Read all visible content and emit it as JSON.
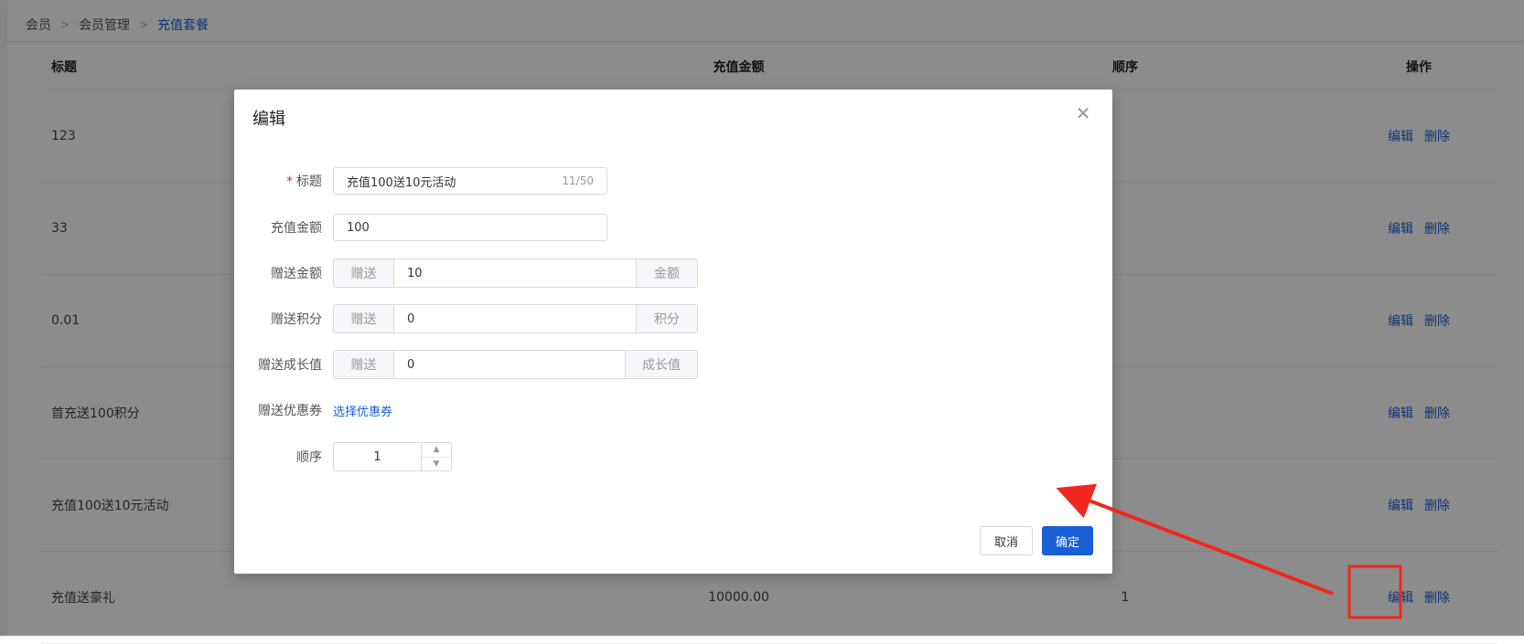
{
  "breadcrumb": [
    "会员",
    "会员管理",
    "充值套餐"
  ],
  "table": {
    "columns": [
      "标题",
      "充值金额",
      "顺序",
      "操作"
    ],
    "rows": [
      {
        "title": "123",
        "amount": "",
        "order": ""
      },
      {
        "title": "33",
        "amount": "",
        "order": ""
      },
      {
        "title": "0.01",
        "amount": "",
        "order": ""
      },
      {
        "title": "首充送100积分",
        "amount": "",
        "order": ""
      },
      {
        "title": "充值100送10元活动",
        "amount": "",
        "order": ""
      },
      {
        "title": "充值送豪礼",
        "amount": "10000.00",
        "order": "1"
      }
    ],
    "edit_label": "编辑",
    "delete_label": "删除"
  },
  "dialog": {
    "title": "编辑",
    "fields": {
      "title_label": "标题",
      "title_value": "充值100送10元活动",
      "title_count": "11/50",
      "amount_label": "充值金额",
      "amount_value": "100",
      "gift_amount_label": "赠送金额",
      "gift_amount_prefix": "赠送",
      "gift_amount_value": "10",
      "gift_amount_suffix": "金额",
      "gift_points_label": "赠送积分",
      "gift_points_prefix": "赠送",
      "gift_points_value": "0",
      "gift_points_suffix": "积分",
      "gift_growth_label": "赠送成长值",
      "gift_growth_prefix": "赠送",
      "gift_growth_value": "0",
      "gift_growth_suffix": "成长值",
      "coupon_label": "赠送优惠券",
      "coupon_link": "选择优惠券",
      "order_label": "顺序",
      "order_value": "1"
    },
    "cancel_label": "取消",
    "ok_label": "确定"
  },
  "colors": {
    "accent": "#1a5fd6",
    "annotation": "#f0281e"
  },
  "icons": [
    "close-icon",
    "chevron-right-icon",
    "caret-up-icon",
    "caret-down-icon"
  ]
}
